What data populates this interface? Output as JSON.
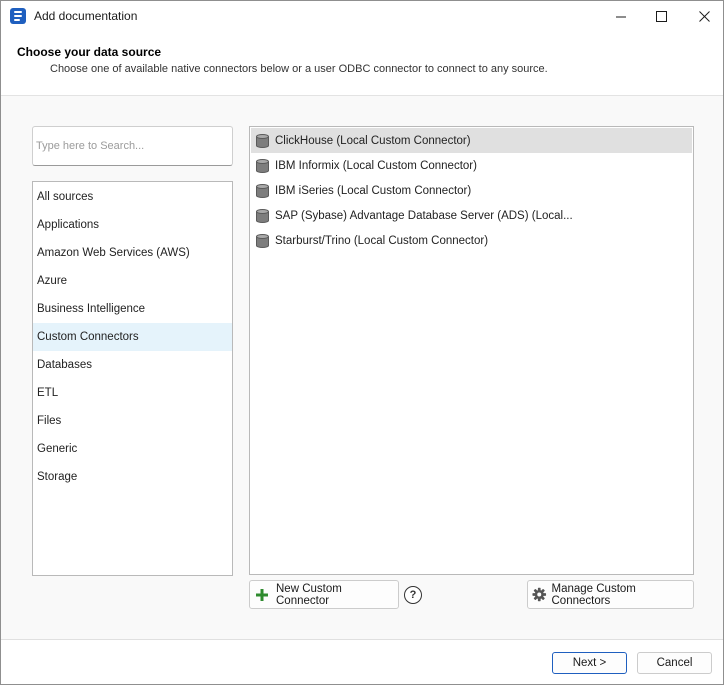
{
  "window": {
    "title": "Add documentation",
    "icons": {
      "app": "database-doc-icon",
      "minimize": "minimize-icon",
      "maximize": "maximize-icon",
      "close": "close-icon"
    }
  },
  "header": {
    "title": "Choose your data source",
    "description": "Choose one of available native connectors below or a user ODBC connector to connect to any source."
  },
  "search": {
    "placeholder": "Type here to Search...",
    "value": ""
  },
  "categories": {
    "selected": "Custom Connectors",
    "items": [
      {
        "label": "All sources"
      },
      {
        "label": "Applications"
      },
      {
        "label": "Amazon Web Services (AWS)"
      },
      {
        "label": "Azure"
      },
      {
        "label": "Business Intelligence"
      },
      {
        "label": "Custom Connectors"
      },
      {
        "label": "Databases"
      },
      {
        "label": "ETL"
      },
      {
        "label": "Files"
      },
      {
        "label": "Generic"
      },
      {
        "label": "Storage"
      }
    ]
  },
  "connectors": {
    "selected": "ClickHouse (Local Custom Connector)",
    "icon": "database-cylinder-icon",
    "items": [
      {
        "label": "ClickHouse (Local Custom Connector)"
      },
      {
        "label": "IBM Informix (Local Custom Connector)"
      },
      {
        "label": "IBM iSeries (Local Custom Connector)"
      },
      {
        "label": "SAP (Sybase) Advantage Database Server (ADS) (Local..."
      },
      {
        "label": "Starburst/Trino (Local Custom Connector)"
      }
    ]
  },
  "actions": {
    "new_connector": "New Custom Connector",
    "help": "?",
    "manage_connectors": "Manage Custom Connectors"
  },
  "footer": {
    "next": "Next >",
    "cancel": "Cancel"
  },
  "colors": {
    "accent": "#1f5fbf",
    "plus_green": "#2e8b2e",
    "selected_category": "#e5f3fb",
    "selected_connector": "#e0e0e0"
  }
}
